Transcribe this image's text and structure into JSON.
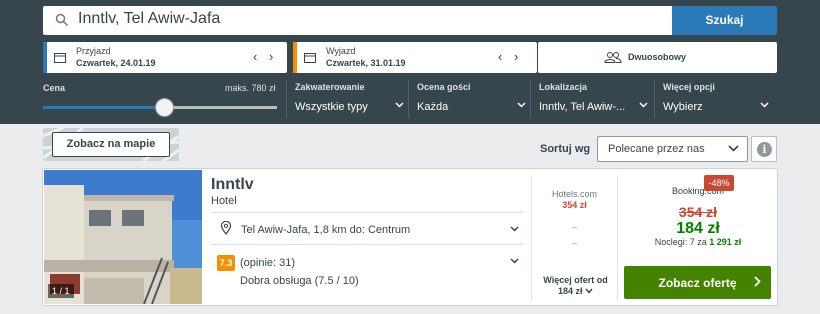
{
  "search": {
    "value": "Inntlv, Tel Awiw-Jafa",
    "button": "Szukaj"
  },
  "checkin": {
    "label": "Przyjazd",
    "value": "Czwartek, 24.01.19",
    "prev": "‹",
    "next": "›"
  },
  "checkout": {
    "label": "Wyjazd",
    "value": "Czwartek, 31.01.19",
    "prev": "‹",
    "next": "›"
  },
  "room": {
    "label": "Dwuosobowy"
  },
  "price_filter": {
    "label": "Cena",
    "max": "maks. 780 zł",
    "level_fraction": 0.52
  },
  "filters": [
    {
      "title": "Zakwaterowanie",
      "value": "Wszystkie typy"
    },
    {
      "title": "Ocena gości",
      "value": "Każda"
    },
    {
      "title": "Lokalizacja",
      "value": "Inntlv, Tel Awiw-..."
    },
    {
      "title": "Więcej opcji",
      "value": "Wybierz"
    }
  ],
  "map_button": "Zobacz na mapie",
  "sort": {
    "label": "Sortuj wg",
    "value": "Polecane przez nas",
    "info": "i"
  },
  "hotel": {
    "photo_count": "1 / 1",
    "name": "Inntlv",
    "type": "Hotel",
    "location": "Tel Awiw-Jafa, 1,8 km do: Centrum",
    "rating": "7.3",
    "reviews": "(opinie: 31)",
    "rating_text": "Dobra obsługa (7.5 / 10)"
  },
  "other_offer": {
    "site": "Hotels.com",
    "price": "354 zł",
    "dash1": "–",
    "dash2": "–",
    "more_line1": "Więcej ofert od",
    "more_line2": "184 zł"
  },
  "best_offer": {
    "discount": "-48%",
    "site": "Booking.com",
    "old_price": "354 zł",
    "new_price": "184 zł",
    "nights_prefix": "Noclegi: 7 za",
    "nights_total": "1 291 zł",
    "button": "Zobacz ofertę"
  },
  "colors": {
    "header": "#37454d",
    "accent_blue": "#2a7ab7",
    "checkin_bar": "#2a7ab7",
    "checkout_bar": "#f48f00",
    "green": "#438300",
    "red": "#c94a30"
  }
}
